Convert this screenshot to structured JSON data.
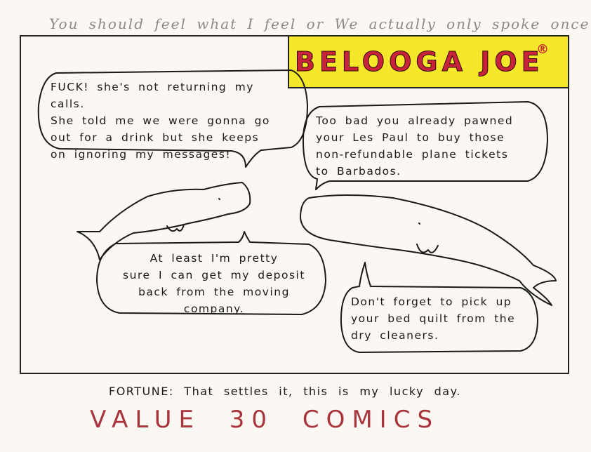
{
  "top_caption": "You should feel what I feel or We actually only spoke once.",
  "title": {
    "text": "BELOOGA JOE",
    "mark": "®"
  },
  "bubbles": [
    {
      "text": "FUCK! she's not returning my calls.\nShe told me we were gonna go\nout for a drink but she keeps\non ignoring my messages!"
    },
    {
      "text": "Too bad you already pawned\nyour Les Paul to buy those\nnon-refundable plane tickets\nto Barbados."
    },
    {
      "text": "At least I'm pretty\nsure I can get my deposit\nback from the moving company."
    },
    {
      "text": "Don't forget to pick up\nyour bed quilt from the\ndry cleaners."
    }
  ],
  "fortune": "FORTUNE: That settles it, this is my lucky day.",
  "value_label": "VALUE 30 COMICS",
  "colors": {
    "title_fill": "#f5e72a",
    "title_text": "#c8233a",
    "value_text": "#a8343c",
    "paper": "#fbf7f2"
  }
}
